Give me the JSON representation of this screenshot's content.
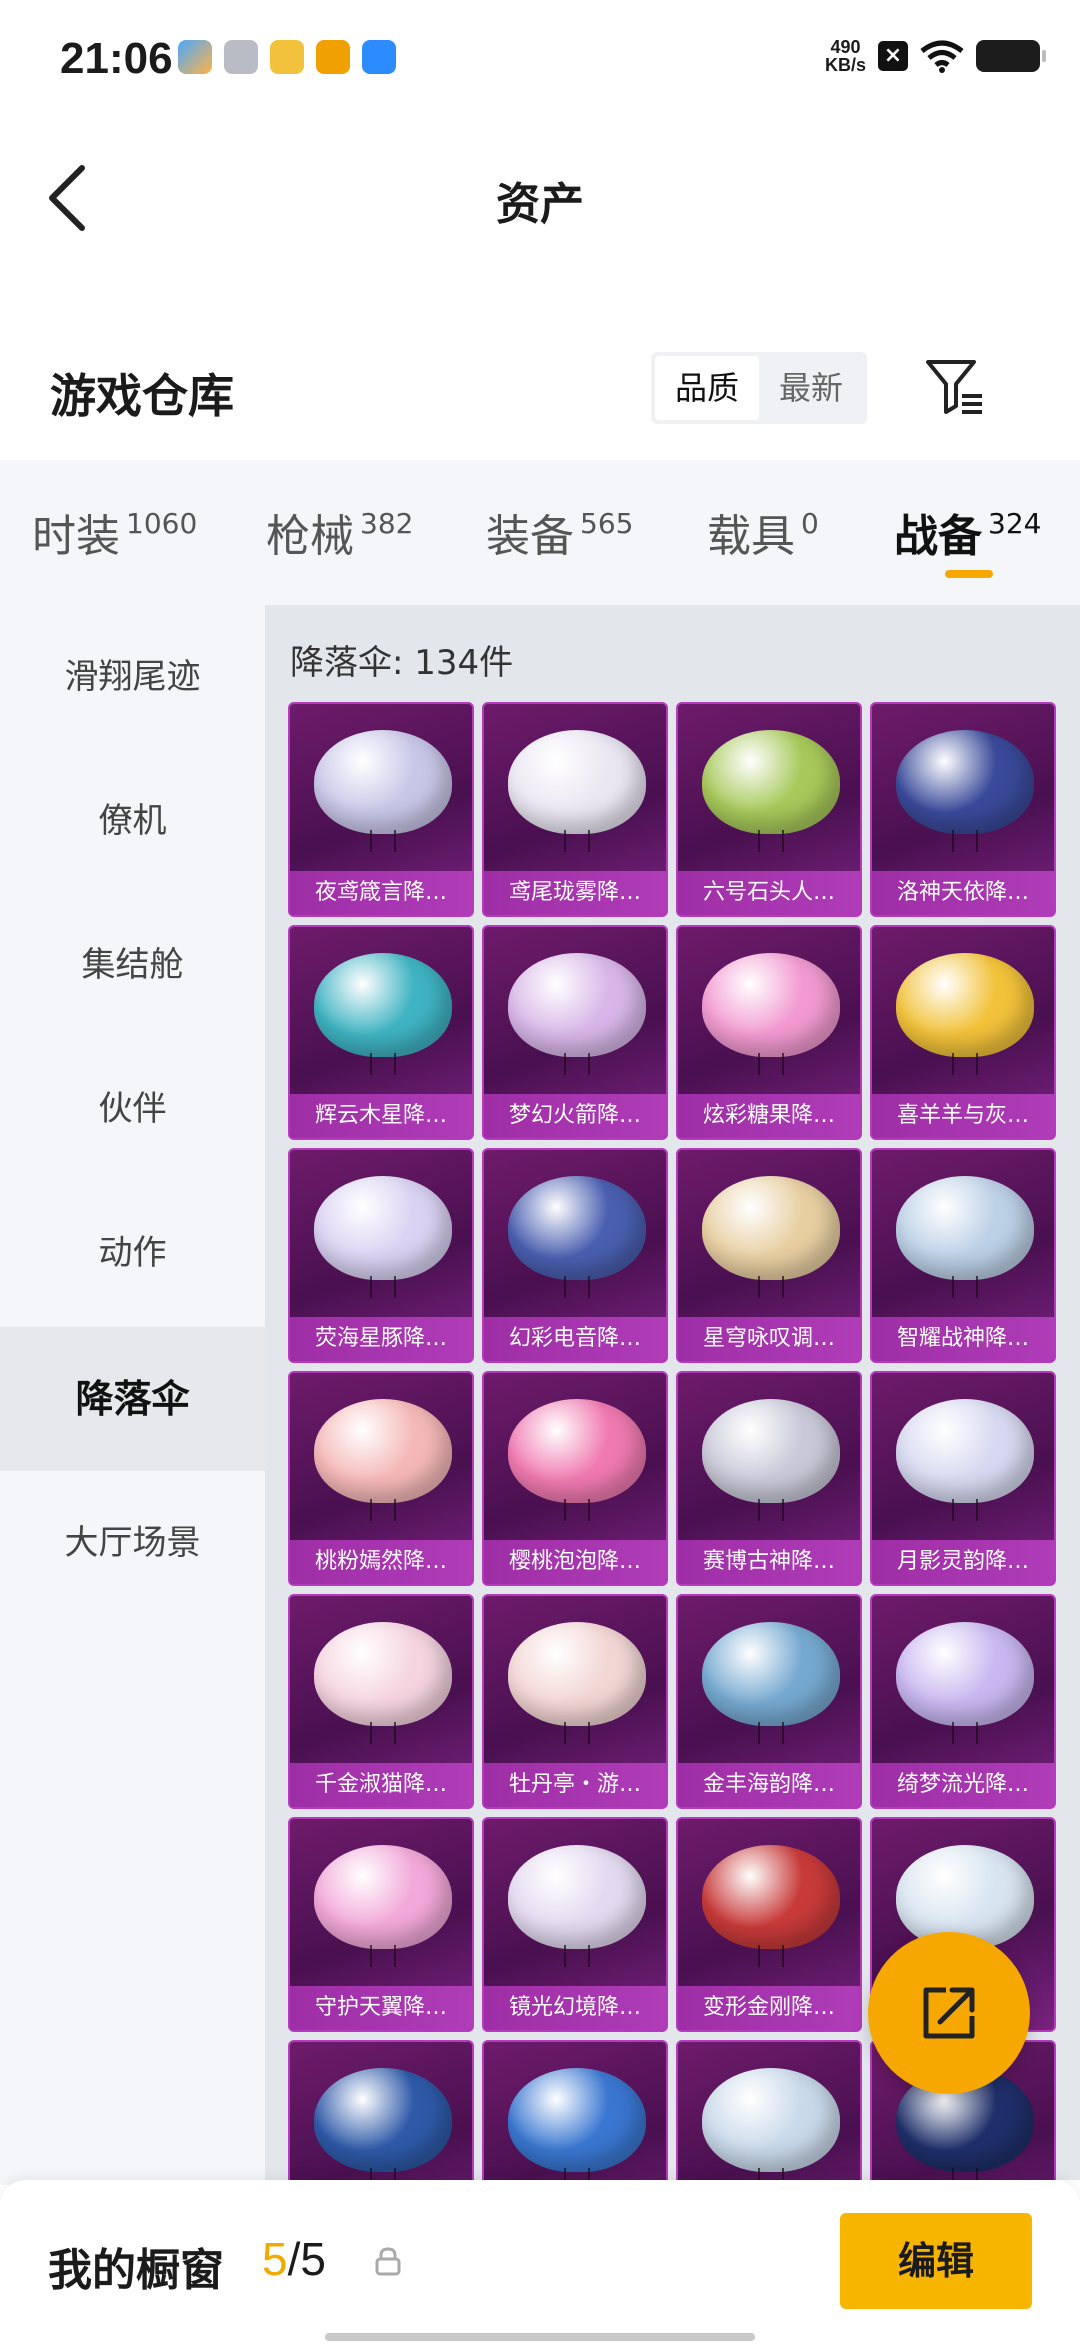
{
  "status_bar": {
    "time": "21:06",
    "net_speed_value": "490",
    "net_speed_unit": "KB/s"
  },
  "header": {
    "title": "资产"
  },
  "warehouse": {
    "title": "游戏仓库",
    "sort_options": [
      "品质",
      "最新"
    ],
    "active_sort": "品质"
  },
  "categories": [
    {
      "label": "时装",
      "count": "1060"
    },
    {
      "label": "枪械",
      "count": "382"
    },
    {
      "label": "装备",
      "count": "565"
    },
    {
      "label": "载具",
      "count": "0"
    },
    {
      "label": "战备",
      "count": "324"
    }
  ],
  "active_category": "战备",
  "sidebar": [
    {
      "label": "滑翔尾迹"
    },
    {
      "label": "僚机"
    },
    {
      "label": "集结舱"
    },
    {
      "label": "伙伴"
    },
    {
      "label": "动作"
    },
    {
      "label": "降落伞"
    },
    {
      "label": "大厅场景"
    }
  ],
  "active_sidebar": "降落伞",
  "content": {
    "count_label": "降落伞: 134件",
    "items": [
      {
        "name": "夜鸢箴言降…",
        "color": "#c9c7e8"
      },
      {
        "name": "鸢尾珑雾降…",
        "color": "#eae6f2"
      },
      {
        "name": "六号石头人…",
        "color": "#a7c95a"
      },
      {
        "name": "洛神天依降…",
        "color": "#3a4a9a"
      },
      {
        "name": "辉云木星降…",
        "color": "#3fb3c2"
      },
      {
        "name": "梦幻火箭降…",
        "color": "#d8b7e8"
      },
      {
        "name": "炫彩糖果降…",
        "color": "#f29ad0"
      },
      {
        "name": "喜羊羊与灰…",
        "color": "#f2c23a"
      },
      {
        "name": "荧海星豚降…",
        "color": "#d9d2f2"
      },
      {
        "name": "幻彩电音降…",
        "color": "#4a5fb0"
      },
      {
        "name": "星穹咏叹调…",
        "color": "#e8cfa2"
      },
      {
        "name": "智耀战神降…",
        "color": "#bcd0e6"
      },
      {
        "name": "桃粉嫣然降…",
        "color": "#f5b8b8"
      },
      {
        "name": "樱桃泡泡降…",
        "color": "#f07ab0"
      },
      {
        "name": "赛博古神降…",
        "color": "#c9c9d8"
      },
      {
        "name": "月影灵韵降…",
        "color": "#d7d9f0"
      },
      {
        "name": "千金淑猫降…",
        "color": "#f5d4e0"
      },
      {
        "name": "牡丹亭・游…",
        "color": "#f2d6d4"
      },
      {
        "name": "金丰海韵降…",
        "color": "#76a9d1"
      },
      {
        "name": "绮梦流光降…",
        "color": "#c8b7f0"
      },
      {
        "name": "守护天翼降…",
        "color": "#f2a8d8"
      },
      {
        "name": "镜光幻境降…",
        "color": "#e3d9f0"
      },
      {
        "name": "变形金刚降…",
        "color": "#c83a3a"
      },
      {
        "name": "",
        "color": "#d8e4f0"
      },
      {
        "name": "",
        "color": "#2e5aa8"
      },
      {
        "name": "",
        "color": "#3a77d1"
      },
      {
        "name": "",
        "color": "#c9d9ea"
      },
      {
        "name": "",
        "color": "#1f2f6a"
      }
    ]
  },
  "bottom_bar": {
    "label": "我的橱窗",
    "current": "5",
    "separator": "/",
    "total": "5",
    "edit_label": "编辑"
  },
  "colors": {
    "accent": "#f7a800",
    "card_bg": "#5a1560",
    "label_bg": "#a632ae"
  }
}
